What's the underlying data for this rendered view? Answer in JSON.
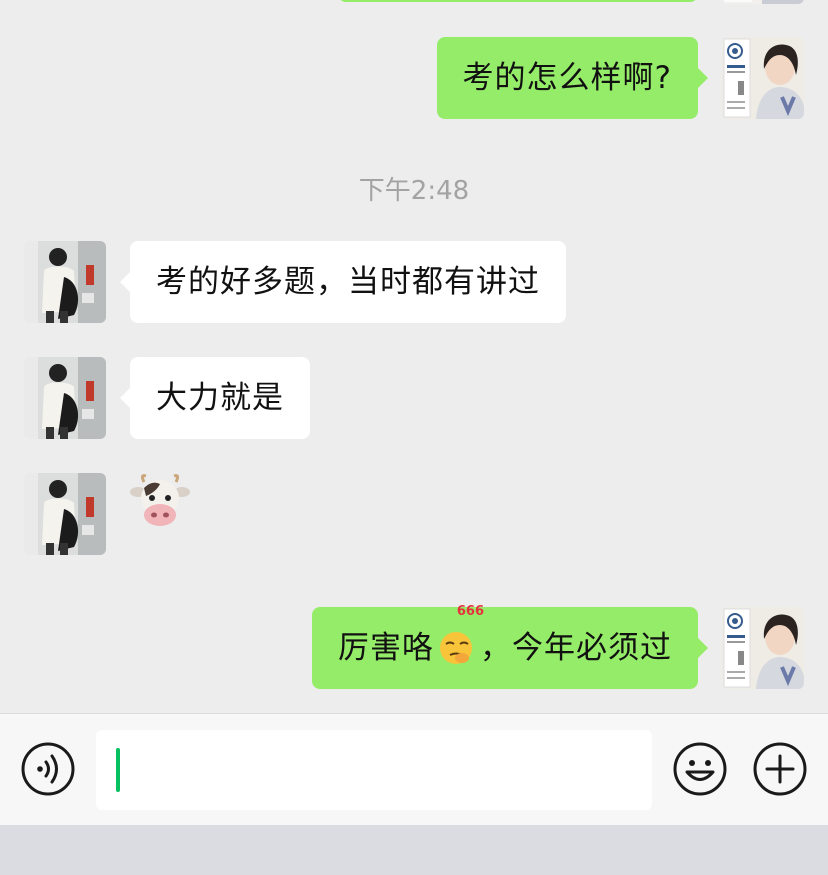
{
  "conversation": {
    "time_divider": "下午2:48",
    "messages": [
      {
        "side": "me",
        "text": "考的怎么样啊?"
      },
      {
        "side": "other",
        "text": "考的好多题，当时都有讲过"
      },
      {
        "side": "other",
        "text": "大力就是"
      },
      {
        "side": "other",
        "sticker": "cow-face-emoji",
        "glyph": "🐮"
      },
      {
        "side": "me",
        "text_before": "厉害咯",
        "emoji": "thinking-face-666-emoji",
        "emoji_label": "666",
        "text_after": "，今年必须过"
      }
    ]
  },
  "input_bar": {
    "voice_icon": "voice-input-icon",
    "emoji_icon": "emoji-icon",
    "more_icon": "plus-icon",
    "text_value": ""
  },
  "colors": {
    "my_bubble": "#95ec69",
    "other_bubble": "#ffffff",
    "background": "#ededed",
    "caret": "#07c160"
  }
}
